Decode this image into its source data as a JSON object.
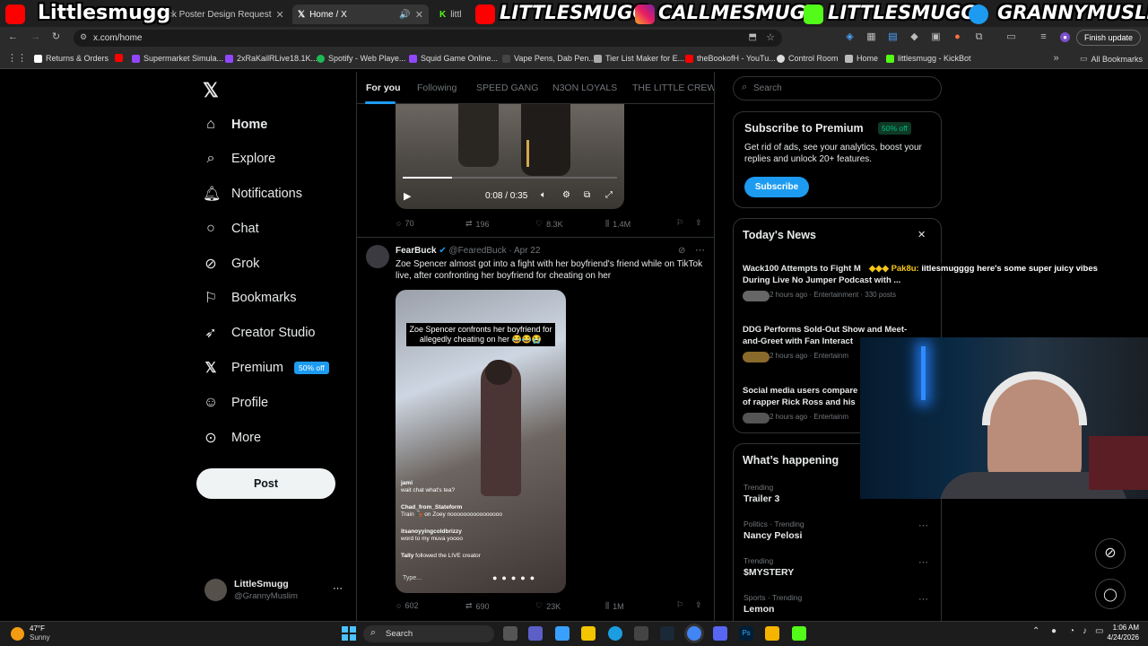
{
  "browser": {
    "tabs": [
      {
        "title": "Kick Poster Design Request"
      },
      {
        "title": "Home / X"
      },
      {
        "title": "littl"
      }
    ],
    "url": "x.com/home",
    "finish_update": "Finish update",
    "bookmarks": [
      "Returns & Orders",
      "Supermarket Simula...",
      "2xRaKailRLive18.1K...",
      "Spotify - Web Playe...",
      "Squid Game Online...",
      "Vape Pens, Dab Pen...",
      "Tier List Maker for E...",
      "theBookofH - YouTu...",
      "Control Room",
      "Home",
      "littlesmugg - KickBot"
    ],
    "all_bookmarks": "All Bookmarks"
  },
  "overlay": {
    "left_name": "Littlesmugg",
    "socials": [
      "LITTLESMUGG",
      "CALLMESMUGG",
      "LITTLESMUGG",
      "GRANNYMUSLIM"
    ],
    "chat_user": "Pak8u:",
    "chat_message": "iitlesmugggg here's some super juicy vibes"
  },
  "sidebar": {
    "items": [
      {
        "label": "Home"
      },
      {
        "label": "Explore"
      },
      {
        "label": "Notifications"
      },
      {
        "label": "Chat"
      },
      {
        "label": "Grok"
      },
      {
        "label": "Bookmarks"
      },
      {
        "label": "Creator Studio"
      },
      {
        "label": "Premium"
      },
      {
        "label": "Profile"
      },
      {
        "label": "More"
      }
    ],
    "premium_badge": "50% off",
    "post_label": "Post",
    "user": {
      "name": "LittleSmugg",
      "handle": "@GrannyMuslim"
    }
  },
  "feed": {
    "tabs": [
      "For you",
      "Following",
      "SPEED GANG",
      "N3ON LOYALS",
      "THE LITTLE CREW"
    ],
    "video1": {
      "time": "0:08 / 0:35",
      "progress": 0.23,
      "replies": "70",
      "reposts": "196",
      "likes": "8.3K",
      "views": "1.4M"
    },
    "post2": {
      "name": "FearBuck",
      "handle": "@FearedBuck",
      "date": "Apr 22",
      "text": "Zoe Spencer almost got into a fight with her boyfriend's friend while on TikTok live, after confronting her boyfriend for cheating on her",
      "caption": "Zoe Spencer confronts her boyfriend for allegedly cheating on her 😂😂😭",
      "live_chat": [
        {
          "user": "jami",
          "msg": "wait chat what's tea?"
        },
        {
          "user": "Chad_from_Stateform",
          "msg": "Train 🚂 on Zoey noooooooooooooooo"
        },
        {
          "user": "itsanoyyingcoldbrizzy",
          "msg": "word to my muva yoooo"
        },
        {
          "user": "Tally",
          "msg": "followed the LIVE creator"
        }
      ],
      "type_placeholder": "Type...",
      "replies": "602",
      "reposts": "690",
      "likes": "23K",
      "views": "1M"
    }
  },
  "right": {
    "search_placeholder": "Search",
    "premium": {
      "title": "Subscribe to Premium",
      "badge": "50% off",
      "body": "Get rid of ads, see your analytics, boost your replies and unlock 20+ features.",
      "button": "Subscribe"
    },
    "news": {
      "title": "Today's News",
      "items": [
        {
          "title": "Wack100 Attempts to Fight M",
          "title2": "During Live No Jumper Podcast with ...",
          "meta": "2 hours ago · Entertainment · 330 posts"
        },
        {
          "title": "DDG Performs Sold-Out Show and Meet-",
          "title2": "and-Greet with Fan Interact",
          "meta": "2 hours ago · Entertainm"
        },
        {
          "title": "Social media users compare",
          "title2": "of rapper Rick Ross and his",
          "meta": "2 hours ago · Entertainm"
        }
      ]
    },
    "happening": {
      "title": "What’s happening",
      "trends": [
        {
          "sub": "Trending",
          "title": "Trailer 3"
        },
        {
          "sub": "Politics · Trending",
          "title": "Nancy Pelosi"
        },
        {
          "sub": "Trending",
          "title": "$MYSTERY"
        },
        {
          "sub": "Sports · Trending",
          "title": "Lemon"
        }
      ]
    }
  },
  "taskbar": {
    "weather_temp": "47°F",
    "weather_desc": "Sunny",
    "search": "Search",
    "time": "1:06 AM",
    "date": "4/24/2026"
  },
  "colors": {
    "accent": "#1d9bf0",
    "background": "#000000",
    "border": "#2f3336",
    "muted": "#71767b"
  }
}
